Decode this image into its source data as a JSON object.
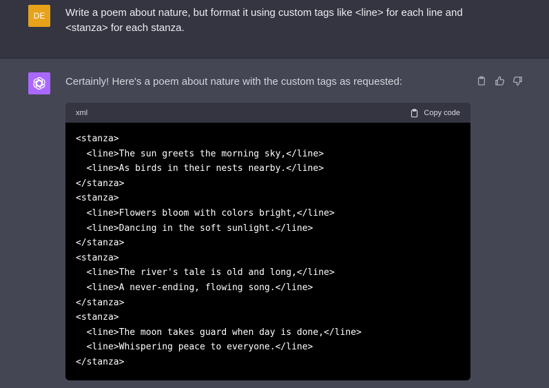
{
  "user": {
    "avatar_initials": "DE",
    "avatar_color": "#e8a21a",
    "message": "Write a poem about nature, but format it using custom tags like <line> for each line and <stanza> for each stanza."
  },
  "assistant": {
    "avatar_icon": "openai-logo-icon",
    "avatar_color": "#ab68ff",
    "intro": "Certainly! Here's a poem about nature with the custom tags as requested:",
    "feedback_icons": [
      "clipboard-icon",
      "thumbs-up-icon",
      "thumbs-down-icon"
    ]
  },
  "code_block": {
    "language": "xml",
    "copy_label": "Copy code",
    "lines": [
      "<stanza>",
      "  <line>The sun greets the morning sky,</line>",
      "  <line>As birds in their nests nearby.</line>",
      "</stanza>",
      "<stanza>",
      "  <line>Flowers bloom with colors bright,</line>",
      "  <line>Dancing in the soft sunlight.</line>",
      "</stanza>",
      "<stanza>",
      "  <line>The river's tale is old and long,</line>",
      "  <line>A never-ending, flowing song.</line>",
      "</stanza>",
      "<stanza>",
      "  <line>The moon takes guard when day is done,</line>",
      "  <line>Whispering peace to everyone.</line>",
      "</stanza>"
    ]
  }
}
